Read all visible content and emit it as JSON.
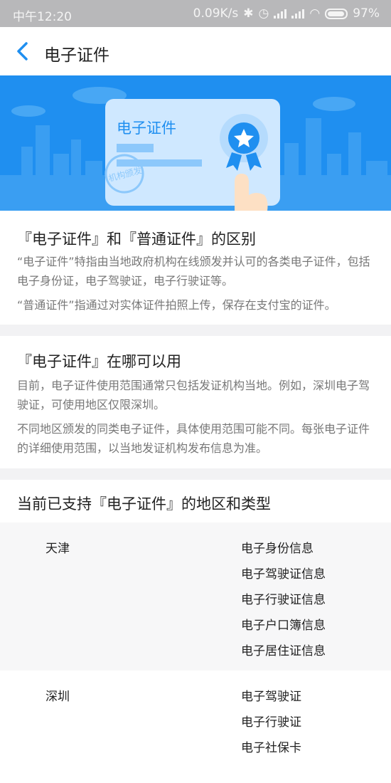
{
  "status_bar": {
    "time": "中午12:20",
    "speed": "0.09K/s",
    "battery": "97%"
  },
  "nav": {
    "title": "电子证件"
  },
  "banner": {
    "card_title": "电子证件",
    "stamp_text": "机构颁发"
  },
  "section1": {
    "title": "『电子证件』和『普通证件』的区别",
    "para1": "“电子证件”特指由当地政府机构在线颁发并认可的各类电子证件，包括电子身份证，电子驾驶证，电子行驶证等。",
    "para2": "“普通证件”指通过对实体证件拍照上传，保存在支付宝的证件。"
  },
  "section2": {
    "title": "『电子证件』在哪可以用",
    "para1": "目前，电子证件使用范围通常只包括发证机构当地。例如，深圳电子驾驶证，可使用地区仅限深圳。",
    "para2": "不同地区颁发的同类电子证件，具体使用范围可能不同。每张电子证件的详细使用范围，以当地发证机构发布信息为准。"
  },
  "section3": {
    "title": "当前已支持『电子证件』的地区和类型",
    "regions": [
      {
        "name": "天津",
        "types": [
          "电子身份信息",
          "电子驾驶证信息",
          "电子行驶证信息",
          "电子户口簿信息",
          "电子居住证信息"
        ]
      },
      {
        "name": "深圳",
        "types": [
          "电子驾驶证",
          "电子行驶证",
          "电子社保卡"
        ]
      }
    ]
  },
  "colors": {
    "accent": "#1f8ff0",
    "banner_bg": "#1f8ff0",
    "card_bg": "#cfe8ff",
    "status_bar": "#b8b8ba"
  }
}
